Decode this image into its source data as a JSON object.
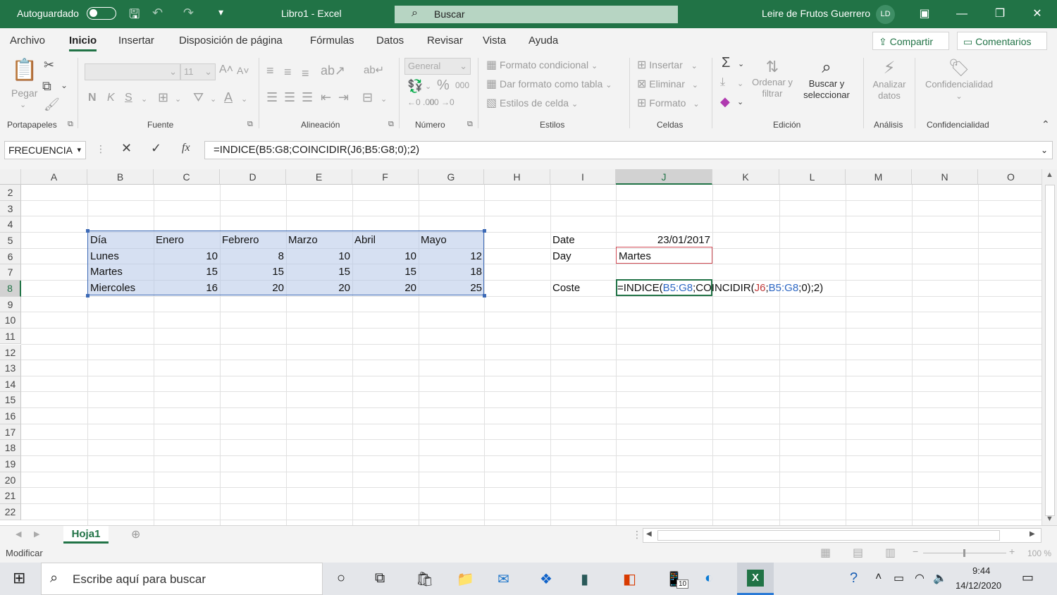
{
  "titlebar": {
    "autosave_label": "Autoguardado",
    "doc_title": "Libro1  -  Excel",
    "search_placeholder": "Buscar",
    "user_name": "Leire de Frutos Guerrero",
    "user_initials": "LD"
  },
  "menu": {
    "tabs": [
      "Archivo",
      "Inicio",
      "Insertar",
      "Disposición de página",
      "Fórmulas",
      "Datos",
      "Revisar",
      "Vista",
      "Ayuda"
    ],
    "active_tab": "Inicio",
    "share_label": "Compartir",
    "comments_label": "Comentarios"
  },
  "ribbon": {
    "paste_label": "Pegar",
    "font_size": "11",
    "number_format": "General",
    "percent_symbol": "%",
    "thousands_symbol": "000",
    "bold": "N",
    "italic": "K",
    "underline": "S",
    "conditional_format": "Formato condicional",
    "format_as_table": "Dar formato como tabla",
    "cell_styles": "Estilos de celda",
    "insert_label": "Insertar",
    "delete_label": "Eliminar",
    "format_label": "Formato",
    "sort_filter_line1": "Ordenar y",
    "sort_filter_line2": "filtrar",
    "find_select_line1": "Buscar y",
    "find_select_line2": "seleccionar",
    "analyze_line1": "Analizar",
    "analyze_line2": "datos",
    "sensitivity_label": "Confidencialidad",
    "groups": {
      "clipboard": "Portapapeles",
      "font": "Fuente",
      "alignment": "Alineación",
      "number": "Número",
      "styles": "Estilos",
      "cells": "Celdas",
      "editing": "Edición",
      "analysis": "Análisis",
      "sensitivity": "Confidencialidad"
    }
  },
  "formula_bar": {
    "name_box": "FRECUENCIA",
    "fx": "fx",
    "formula": "=INDICE(B5:G8;COINCIDIR(J6;B5:G8;0);2)"
  },
  "grid": {
    "columns": [
      "A",
      "B",
      "C",
      "D",
      "E",
      "F",
      "G",
      "H",
      "I",
      "J",
      "K",
      "L",
      "M",
      "N",
      "O"
    ],
    "selected_column": "J",
    "rows": [
      "2",
      "3",
      "4",
      "5",
      "6",
      "7",
      "8",
      "9",
      "10",
      "11",
      "12",
      "13",
      "14",
      "15",
      "16",
      "17",
      "18",
      "19",
      "20",
      "21",
      "22"
    ],
    "selected_row": "8",
    "table": {
      "headers": [
        "Día",
        "Enero",
        "Febrero",
        "Marzo",
        "Abril",
        "Mayo"
      ],
      "rows": [
        [
          "Lunes",
          "10",
          "8",
          "10",
          "10",
          "12"
        ],
        [
          "Martes",
          "15",
          "15",
          "15",
          "15",
          "18"
        ],
        [
          "Miercoles",
          "16",
          "20",
          "20",
          "20",
          "25"
        ]
      ]
    },
    "side": {
      "date_label": "Date",
      "date_value": "23/01/2017",
      "day_label": "Day",
      "day_value": "Martes",
      "cost_label": "Coste",
      "formula_parts": [
        "=INDICE(",
        "B5:G8",
        ";COINCIDIR(",
        "J6",
        ";",
        "B5:G8",
        ";0);2)"
      ]
    }
  },
  "sheet_tabs": {
    "active": "Hoja1"
  },
  "status": {
    "mode": "Modificar",
    "zoom": "100 %"
  },
  "taskbar": {
    "search_placeholder": "Escribe aquí para buscar",
    "time": "9:44",
    "date": "14/12/2020",
    "badge": "10"
  },
  "colors": {
    "excel_green": "#217346",
    "selection_blue": "#3d6ab6",
    "ref_red": "#d24d57"
  }
}
